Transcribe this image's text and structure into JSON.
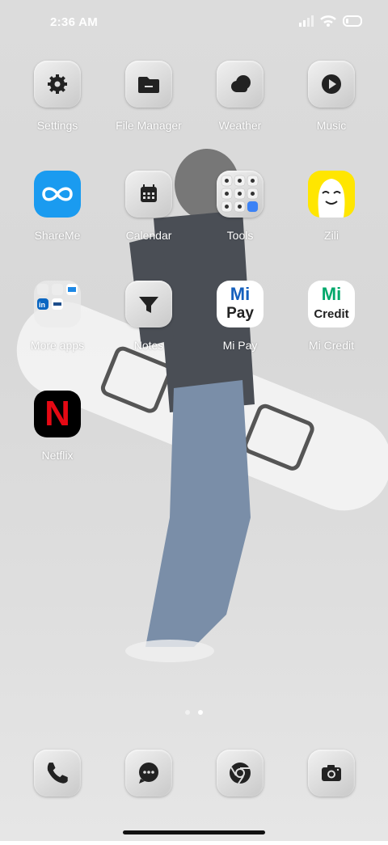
{
  "status": {
    "time": "2:36 AM"
  },
  "apps": [
    {
      "label": "Settings",
      "icon": "gear-icon"
    },
    {
      "label": "File Manager",
      "icon": "folder-icon"
    },
    {
      "label": "Weather",
      "icon": "cloud-icon"
    },
    {
      "label": "Music",
      "icon": "play-icon"
    },
    {
      "label": "ShareMe",
      "icon": "infinity-icon"
    },
    {
      "label": "Calendar",
      "icon": "calendar-icon"
    },
    {
      "label": "Tools",
      "icon": "tools-grid-icon"
    },
    {
      "label": "Zili",
      "icon": "zili-face-icon"
    },
    {
      "label": "More apps",
      "icon": "app-folder-icon"
    },
    {
      "label": "Notes",
      "icon": "notes-funnel-icon"
    },
    {
      "label": "Mi Pay",
      "icon": "mipay-logo-icon"
    },
    {
      "label": "Mi Credit",
      "icon": "micredit-logo-icon"
    },
    {
      "label": "Netflix",
      "icon": "netflix-icon"
    }
  ],
  "logos": {
    "mipay_mi": "Mi",
    "mipay_text": "Pay",
    "micredit_mi": "Mi",
    "micredit_text": "Credit",
    "netflix_n": "N"
  },
  "page_indicator": {
    "count": 2,
    "active": 2
  },
  "dock": [
    {
      "icon": "phone-icon"
    },
    {
      "icon": "messages-icon"
    },
    {
      "icon": "chrome-icon"
    },
    {
      "icon": "camera-icon"
    }
  ],
  "colors": {
    "shareme": "#1a9bf0",
    "zili": "#ffe600",
    "netflix": "#e50914",
    "mi_green": "#00a86b",
    "mi_blue": "#1560bd"
  }
}
